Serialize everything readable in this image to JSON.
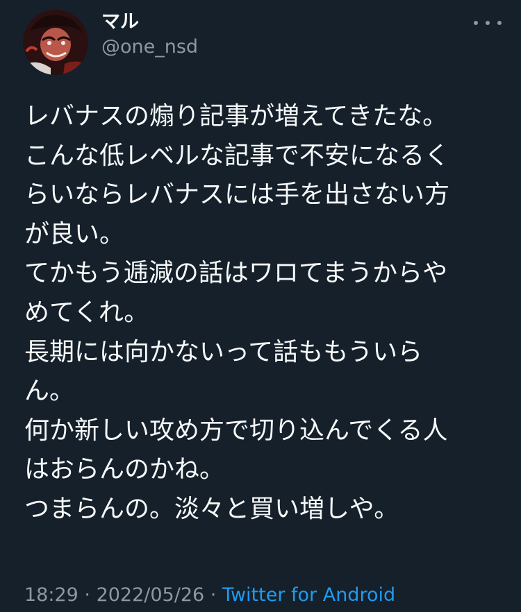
{
  "author": {
    "display_name": "マル",
    "handle": "@one_nsd"
  },
  "icons": {
    "more": "more-horizontal-icon"
  },
  "tweet": {
    "lines": [
      "レバナスの煽り記事が増えてきたな。",
      "こんな低レベルな記事で不安になるく",
      "らいならレバナスには手を出さない方",
      "が良い。",
      "てかもう逓減の話はワロてまうからや",
      "めてくれ。",
      "長期には向かないって話ももういら",
      "ん。",
      "何か新しい攻め方で切り込んでくる人",
      "はおらんのかね。",
      "つまらんの。淡々と買い増しや。"
    ]
  },
  "meta": {
    "time": "18:29",
    "separator1": " · ",
    "date": "2022/05/26",
    "separator2": " · ",
    "source": "Twitter for Android"
  },
  "colors": {
    "background": "#15202b",
    "text": "#f7f9f9",
    "secondary": "#8b98a5",
    "link": "#1d9bf0"
  }
}
